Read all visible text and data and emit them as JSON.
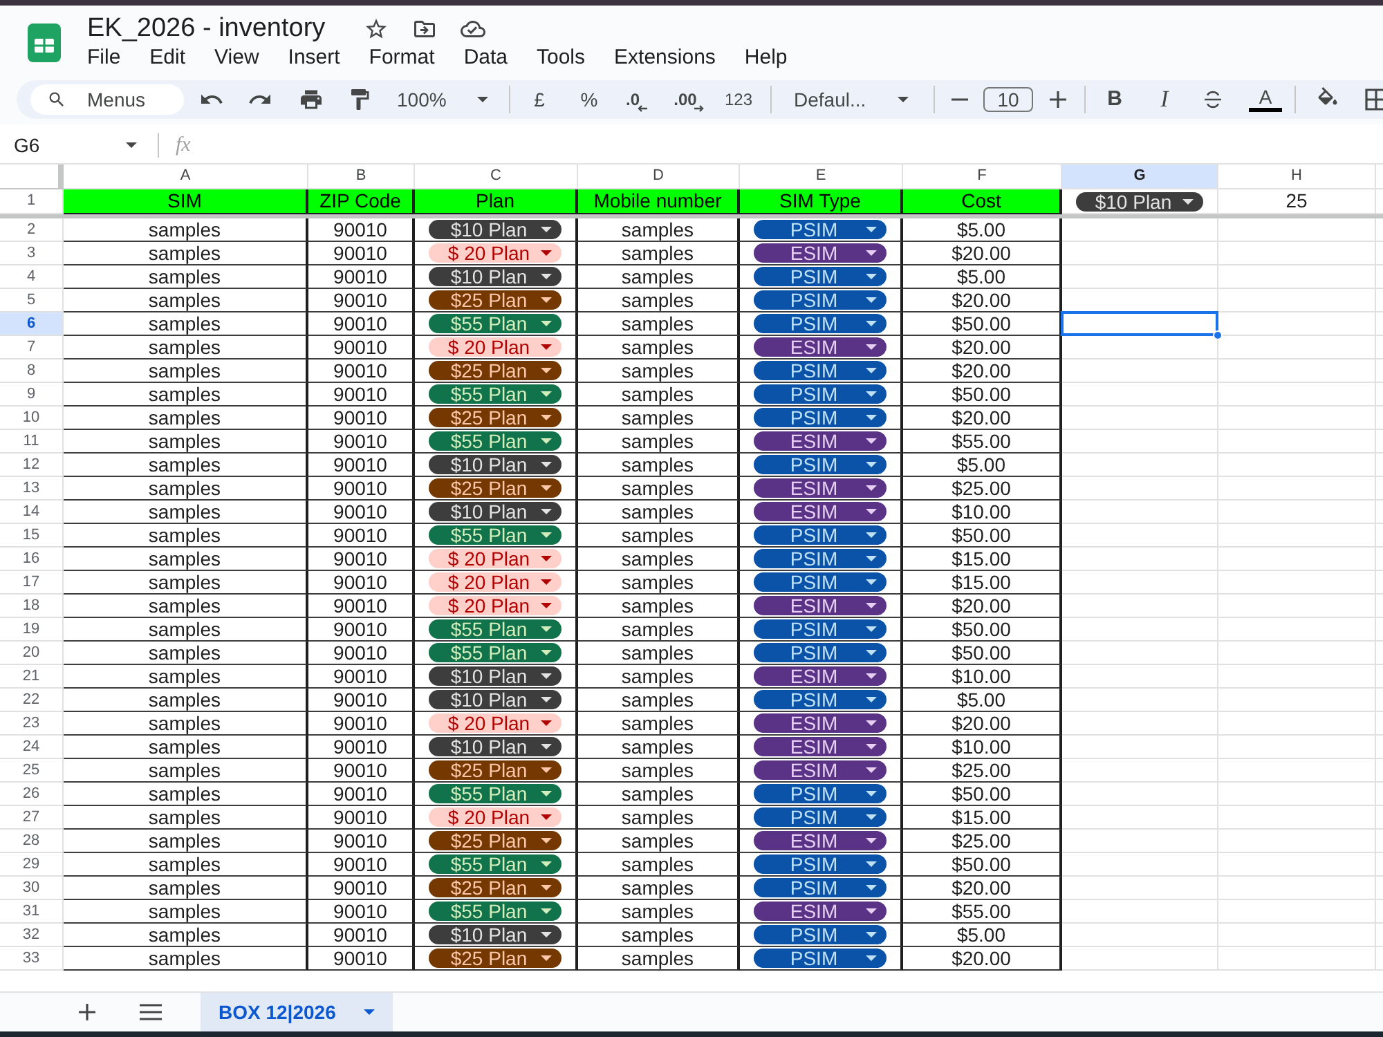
{
  "window": {
    "title": "EK_2026 - inventory"
  },
  "menu_bar": [
    "File",
    "Edit",
    "View",
    "Insert",
    "Format",
    "Data",
    "Tools",
    "Extensions",
    "Help"
  ],
  "toolbar": {
    "menu_search": "Menus",
    "zoom": "100%",
    "currency": "£",
    "percent": "%",
    "decrease_decimals": ".0",
    "increase_decimals": ".00",
    "number_format": "123",
    "font": "Defaul...",
    "font_size": "10",
    "bold": "B",
    "italic": "I",
    "text_color": "A"
  },
  "formula_bar": {
    "cell_reference": "G6",
    "formula_label": "fx"
  },
  "sheet": {
    "columns": [
      {
        "label": "A",
        "selected": false
      },
      {
        "label": "B",
        "selected": false
      },
      {
        "label": "C",
        "selected": false
      },
      {
        "label": "D",
        "selected": false
      },
      {
        "label": "E",
        "selected": false
      },
      {
        "label": "F",
        "selected": false
      },
      {
        "label": "G",
        "selected": true
      },
      {
        "label": "H",
        "selected": false
      }
    ],
    "header_row": {
      "row": "1",
      "selected": false,
      "cells": [
        "SIM",
        "ZIP Code",
        "Plan",
        "Mobile number",
        "SIM Type",
        "Cost"
      ],
      "column_g": {
        "text": "$10 Plan",
        "color": "#3d3d3d"
      },
      "column_h": "25"
    },
    "rows": [
      {
        "row": "2",
        "selected": false,
        "sim": "samples",
        "zip_code": "90010",
        "plan": {
          "text": "$10 Plan",
          "color": "#3d3d3d"
        },
        "mobile_number": "samples",
        "sim_type": {
          "text": "PSIM",
          "color": "#0a53a8"
        },
        "cost": "$5.00"
      },
      {
        "row": "3",
        "selected": false,
        "sim": "samples",
        "zip_code": "90010",
        "plan": {
          "text": "$ 20 Plan",
          "color": "#ffcfc9"
        },
        "mobile_number": "samples",
        "sim_type": {
          "text": "ESIM",
          "color": "#5a3286"
        },
        "cost": "$20.00"
      },
      {
        "row": "4",
        "selected": false,
        "sim": "samples",
        "zip_code": "90010",
        "plan": {
          "text": "$10 Plan",
          "color": "#3d3d3d"
        },
        "mobile_number": "samples",
        "sim_type": {
          "text": "PSIM",
          "color": "#0a53a8"
        },
        "cost": "$5.00"
      },
      {
        "row": "5",
        "selected": false,
        "sim": "samples",
        "zip_code": "90010",
        "plan": {
          "text": "$25 Plan",
          "color": "#753800"
        },
        "mobile_number": "samples",
        "sim_type": {
          "text": "PSIM",
          "color": "#0a53a8"
        },
        "cost": "$20.00"
      },
      {
        "row": "6",
        "selected": true,
        "sim": "samples",
        "zip_code": "90010",
        "plan": {
          "text": "$55 Plan",
          "color": "#11734b"
        },
        "mobile_number": "samples",
        "sim_type": {
          "text": "PSIM",
          "color": "#0a53a8"
        },
        "cost": "$50.00"
      },
      {
        "row": "7",
        "selected": false,
        "sim": "samples",
        "zip_code": "90010",
        "plan": {
          "text": "$ 20 Plan",
          "color": "#ffcfc9"
        },
        "mobile_number": "samples",
        "sim_type": {
          "text": "ESIM",
          "color": "#5a3286"
        },
        "cost": "$20.00"
      },
      {
        "row": "8",
        "selected": false,
        "sim": "samples",
        "zip_code": "90010",
        "plan": {
          "text": "$25 Plan",
          "color": "#753800"
        },
        "mobile_number": "samples",
        "sim_type": {
          "text": "PSIM",
          "color": "#0a53a8"
        },
        "cost": "$20.00"
      },
      {
        "row": "9",
        "selected": false,
        "sim": "samples",
        "zip_code": "90010",
        "plan": {
          "text": "$55 Plan",
          "color": "#11734b"
        },
        "mobile_number": "samples",
        "sim_type": {
          "text": "PSIM",
          "color": "#0a53a8"
        },
        "cost": "$50.00"
      },
      {
        "row": "10",
        "selected": false,
        "sim": "samples",
        "zip_code": "90010",
        "plan": {
          "text": "$25 Plan",
          "color": "#753800"
        },
        "mobile_number": "samples",
        "sim_type": {
          "text": "PSIM",
          "color": "#0a53a8"
        },
        "cost": "$20.00"
      },
      {
        "row": "11",
        "selected": false,
        "sim": "samples",
        "zip_code": "90010",
        "plan": {
          "text": "$55 Plan",
          "color": "#11734b"
        },
        "mobile_number": "samples",
        "sim_type": {
          "text": "ESIM",
          "color": "#5a3286"
        },
        "cost": "$55.00"
      },
      {
        "row": "12",
        "selected": false,
        "sim": "samples",
        "zip_code": "90010",
        "plan": {
          "text": "$10 Plan",
          "color": "#3d3d3d"
        },
        "mobile_number": "samples",
        "sim_type": {
          "text": "PSIM",
          "color": "#0a53a8"
        },
        "cost": "$5.00"
      },
      {
        "row": "13",
        "selected": false,
        "sim": "samples",
        "zip_code": "90010",
        "plan": {
          "text": "$25 Plan",
          "color": "#753800"
        },
        "mobile_number": "samples",
        "sim_type": {
          "text": "ESIM",
          "color": "#5a3286"
        },
        "cost": "$25.00"
      },
      {
        "row": "14",
        "selected": false,
        "sim": "samples",
        "zip_code": "90010",
        "plan": {
          "text": "$10 Plan",
          "color": "#3d3d3d"
        },
        "mobile_number": "samples",
        "sim_type": {
          "text": "ESIM",
          "color": "#5a3286"
        },
        "cost": "$10.00"
      },
      {
        "row": "15",
        "selected": false,
        "sim": "samples",
        "zip_code": "90010",
        "plan": {
          "text": "$55 Plan",
          "color": "#11734b"
        },
        "mobile_number": "samples",
        "sim_type": {
          "text": "PSIM",
          "color": "#0a53a8"
        },
        "cost": "$50.00"
      },
      {
        "row": "16",
        "selected": false,
        "sim": "samples",
        "zip_code": "90010",
        "plan": {
          "text": "$ 20 Plan",
          "color": "#ffcfc9"
        },
        "mobile_number": "samples",
        "sim_type": {
          "text": "PSIM",
          "color": "#0a53a8"
        },
        "cost": "$15.00"
      },
      {
        "row": "17",
        "selected": false,
        "sim": "samples",
        "zip_code": "90010",
        "plan": {
          "text": "$ 20 Plan",
          "color": "#ffcfc9"
        },
        "mobile_number": "samples",
        "sim_type": {
          "text": "PSIM",
          "color": "#0a53a8"
        },
        "cost": "$15.00"
      },
      {
        "row": "18",
        "selected": false,
        "sim": "samples",
        "zip_code": "90010",
        "plan": {
          "text": "$ 20 Plan",
          "color": "#ffcfc9"
        },
        "mobile_number": "samples",
        "sim_type": {
          "text": "ESIM",
          "color": "#5a3286"
        },
        "cost": "$20.00"
      },
      {
        "row": "19",
        "selected": false,
        "sim": "samples",
        "zip_code": "90010",
        "plan": {
          "text": "$55 Plan",
          "color": "#11734b"
        },
        "mobile_number": "samples",
        "sim_type": {
          "text": "PSIM",
          "color": "#0a53a8"
        },
        "cost": "$50.00"
      },
      {
        "row": "20",
        "selected": false,
        "sim": "samples",
        "zip_code": "90010",
        "plan": {
          "text": "$55 Plan",
          "color": "#11734b"
        },
        "mobile_number": "samples",
        "sim_type": {
          "text": "PSIM",
          "color": "#0a53a8"
        },
        "cost": "$50.00"
      },
      {
        "row": "21",
        "selected": false,
        "sim": "samples",
        "zip_code": "90010",
        "plan": {
          "text": "$10 Plan",
          "color": "#3d3d3d"
        },
        "mobile_number": "samples",
        "sim_type": {
          "text": "ESIM",
          "color": "#5a3286"
        },
        "cost": "$10.00"
      },
      {
        "row": "22",
        "selected": false,
        "sim": "samples",
        "zip_code": "90010",
        "plan": {
          "text": "$10 Plan",
          "color": "#3d3d3d"
        },
        "mobile_number": "samples",
        "sim_type": {
          "text": "PSIM",
          "color": "#0a53a8"
        },
        "cost": "$5.00"
      },
      {
        "row": "23",
        "selected": false,
        "sim": "samples",
        "zip_code": "90010",
        "plan": {
          "text": "$ 20 Plan",
          "color": "#ffcfc9"
        },
        "mobile_number": "samples",
        "sim_type": {
          "text": "ESIM",
          "color": "#5a3286"
        },
        "cost": "$20.00"
      },
      {
        "row": "24",
        "selected": false,
        "sim": "samples",
        "zip_code": "90010",
        "plan": {
          "text": "$10 Plan",
          "color": "#3d3d3d"
        },
        "mobile_number": "samples",
        "sim_type": {
          "text": "ESIM",
          "color": "#5a3286"
        },
        "cost": "$10.00"
      },
      {
        "row": "25",
        "selected": false,
        "sim": "samples",
        "zip_code": "90010",
        "plan": {
          "text": "$25 Plan",
          "color": "#753800"
        },
        "mobile_number": "samples",
        "sim_type": {
          "text": "ESIM",
          "color": "#5a3286"
        },
        "cost": "$25.00"
      },
      {
        "row": "26",
        "selected": false,
        "sim": "samples",
        "zip_code": "90010",
        "plan": {
          "text": "$55 Plan",
          "color": "#11734b"
        },
        "mobile_number": "samples",
        "sim_type": {
          "text": "PSIM",
          "color": "#0a53a8"
        },
        "cost": "$50.00"
      },
      {
        "row": "27",
        "selected": false,
        "sim": "samples",
        "zip_code": "90010",
        "plan": {
          "text": "$ 20 Plan",
          "color": "#ffcfc9"
        },
        "mobile_number": "samples",
        "sim_type": {
          "text": "PSIM",
          "color": "#0a53a8"
        },
        "cost": "$15.00"
      },
      {
        "row": "28",
        "selected": false,
        "sim": "samples",
        "zip_code": "90010",
        "plan": {
          "text": "$25 Plan",
          "color": "#753800"
        },
        "mobile_number": "samples",
        "sim_type": {
          "text": "ESIM",
          "color": "#5a3286"
        },
        "cost": "$25.00"
      },
      {
        "row": "29",
        "selected": false,
        "sim": "samples",
        "zip_code": "90010",
        "plan": {
          "text": "$55 Plan",
          "color": "#11734b"
        },
        "mobile_number": "samples",
        "sim_type": {
          "text": "PSIM",
          "color": "#0a53a8"
        },
        "cost": "$50.00"
      },
      {
        "row": "30",
        "selected": false,
        "sim": "samples",
        "zip_code": "90010",
        "plan": {
          "text": "$25 Plan",
          "color": "#753800"
        },
        "mobile_number": "samples",
        "sim_type": {
          "text": "PSIM",
          "color": "#0a53a8"
        },
        "cost": "$20.00"
      },
      {
        "row": "31",
        "selected": false,
        "sim": "samples",
        "zip_code": "90010",
        "plan": {
          "text": "$55 Plan",
          "color": "#11734b"
        },
        "mobile_number": "samples",
        "sim_type": {
          "text": "ESIM",
          "color": "#5a3286"
        },
        "cost": "$55.00"
      },
      {
        "row": "32",
        "selected": false,
        "sim": "samples",
        "zip_code": "90010",
        "plan": {
          "text": "$10 Plan",
          "color": "#3d3d3d"
        },
        "mobile_number": "samples",
        "sim_type": {
          "text": "PSIM",
          "color": "#0a53a8"
        },
        "cost": "$5.00"
      },
      {
        "row": "33",
        "selected": false,
        "sim": "samples",
        "zip_code": "90010",
        "plan": {
          "text": "$25 Plan",
          "color": "#753800"
        },
        "mobile_number": "samples",
        "sim_type": {
          "text": "PSIM",
          "color": "#0a53a8"
        },
        "cost": "$20.00"
      }
    ]
  },
  "sheet_tabs": [
    {
      "label": "BOX 12|2026",
      "selected": true
    }
  ]
}
